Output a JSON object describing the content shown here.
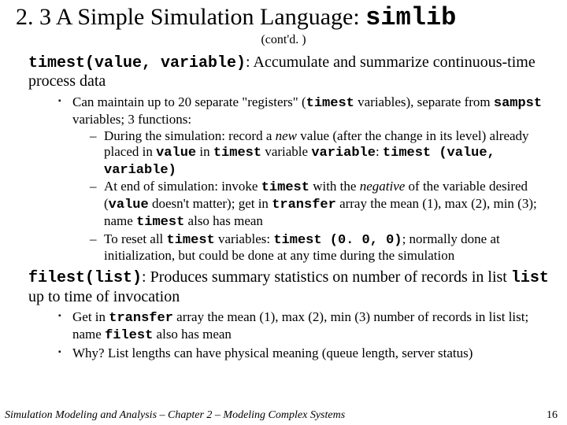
{
  "title": {
    "section": "2. 3",
    "text": "A Simple Simulation Language:",
    "code": "simlib"
  },
  "contd": "(cont'd. )",
  "timest": {
    "sig": "timest(value, variable)",
    "desc": ": Accumulate and summarize continuous-time process data",
    "b1_pre": "Can maintain up to 20 separate \"registers\" (",
    "b1_code1": "timest",
    "b1_mid1": " variables), separate from ",
    "b1_code2": "sampst",
    "b1_post": " variables; 3 functions:",
    "d1_pre": "During the simulation: record a ",
    "d1_em": "new",
    "d1_mid1": " value (after the change in its level) already placed in ",
    "d1_code1": "value",
    "d1_mid2": " in ",
    "d1_code2": "timest",
    "d1_mid3": " variable ",
    "d1_code3": "variable",
    "d1_colon": ": ",
    "d1_call": "timest (value, variable)",
    "d2_pre": "At end of simulation: invoke ",
    "d2_code1": "timest",
    "d2_mid1": " with the ",
    "d2_em": "negative",
    "d2_mid2": " of the variable desired (",
    "d2_code2": "value",
    "d2_mid3": " doesn't matter); get in ",
    "d2_code3": "transfer",
    "d2_mid4": " array the mean (1), max (2), min (3); name ",
    "d2_code4": "timest",
    "d2_post": " also has mean",
    "d3_pre": "To reset all ",
    "d3_code1": "timest",
    "d3_mid1": " variables: ",
    "d3_code2": "timest (0. 0, 0)",
    "d3_post": "; normally done at initialization, but could be done at any time during the simulation"
  },
  "filest": {
    "sig": "filest(list)",
    "desc_pre": ": Produces summary statistics on number of records in list ",
    "desc_code": "list",
    "desc_post": " up to time of invocation",
    "b1_pre": "Get in ",
    "b1_code1": "transfer",
    "b1_mid1": " array the mean (1), max (2), min (3) number of records in list list; name ",
    "b1_code2": "filest",
    "b1_post": " also has mean",
    "b2": "Why?  List lengths can have physical meaning (queue length, server status)"
  },
  "footer": {
    "text": "Simulation Modeling and Analysis – Chapter 2 – Modeling Complex Systems",
    "page": "16"
  }
}
